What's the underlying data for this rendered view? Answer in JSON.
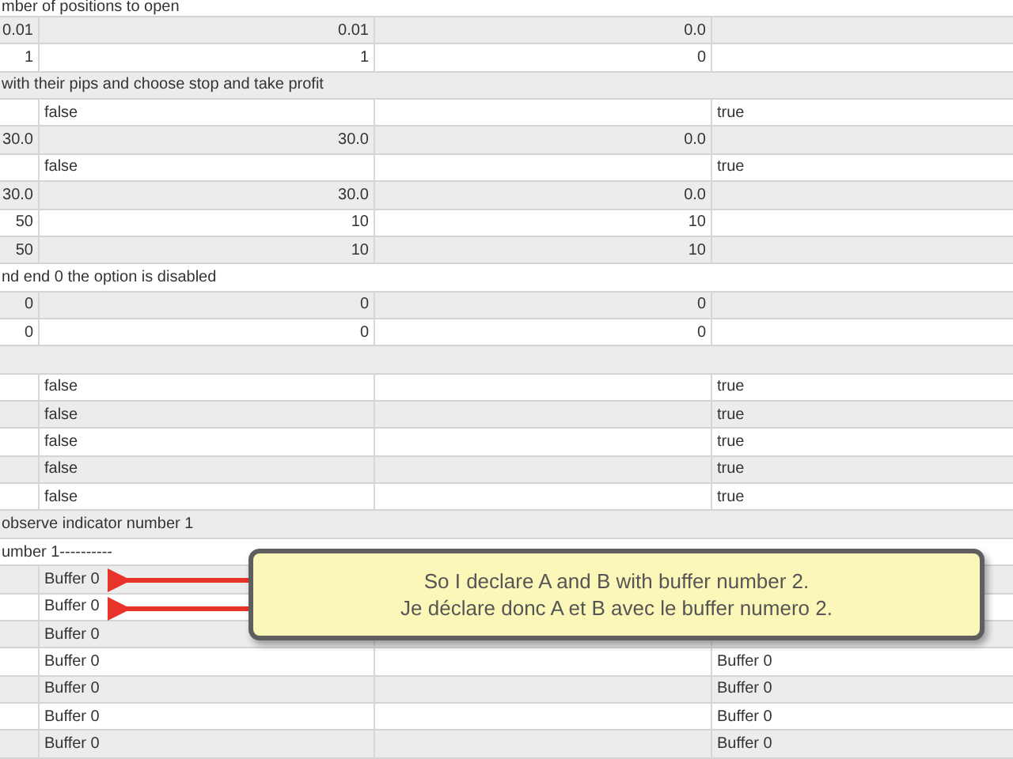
{
  "rows": [
    {
      "kind": "section",
      "label": "mber of positions to open"
    },
    {
      "kind": "numeric",
      "cells": [
        "0.01",
        "0.01",
        "0.0",
        ""
      ]
    },
    {
      "kind": "numeric",
      "cells": [
        "1",
        "1",
        "0",
        ""
      ]
    },
    {
      "kind": "section",
      "label": "with their pips and choose stop and take profit"
    },
    {
      "kind": "text",
      "cells": [
        "",
        "false",
        "",
        "true"
      ]
    },
    {
      "kind": "numeric",
      "cells": [
        "30.0",
        "30.0",
        "0.0",
        ""
      ]
    },
    {
      "kind": "text",
      "cells": [
        "",
        "false",
        "",
        "true"
      ]
    },
    {
      "kind": "numeric",
      "cells": [
        "30.0",
        "30.0",
        "0.0",
        ""
      ]
    },
    {
      "kind": "numeric",
      "cells": [
        "50",
        "10",
        "10",
        ""
      ]
    },
    {
      "kind": "numeric",
      "cells": [
        "50",
        "10",
        "10",
        ""
      ]
    },
    {
      "kind": "section",
      "label": "nd end 0 the option is disabled"
    },
    {
      "kind": "numeric",
      "cells": [
        "0",
        "0",
        "0",
        ""
      ]
    },
    {
      "kind": "numeric",
      "cells": [
        "0",
        "0",
        "0",
        ""
      ]
    },
    {
      "kind": "section",
      "label": ""
    },
    {
      "kind": "text",
      "cells": [
        "",
        "false",
        "",
        "true"
      ]
    },
    {
      "kind": "text",
      "cells": [
        "",
        "false",
        "",
        "true"
      ]
    },
    {
      "kind": "text",
      "cells": [
        "",
        "false",
        "",
        "true"
      ]
    },
    {
      "kind": "text",
      "cells": [
        "",
        "false",
        "",
        "true"
      ]
    },
    {
      "kind": "text",
      "cells": [
        "",
        "false",
        "",
        "true"
      ]
    },
    {
      "kind": "section",
      "label": "observe indicator number 1"
    },
    {
      "kind": "section",
      "label": "umber 1----------"
    },
    {
      "kind": "text",
      "cells": [
        "",
        "Buffer 0",
        "",
        ""
      ]
    },
    {
      "kind": "text",
      "cells": [
        "",
        "Buffer 0",
        "",
        ""
      ]
    },
    {
      "kind": "text",
      "cells": [
        "",
        "Buffer 0",
        "",
        ""
      ]
    },
    {
      "kind": "text",
      "cells": [
        "",
        "Buffer 0",
        "",
        "Buffer 0"
      ]
    },
    {
      "kind": "text",
      "cells": [
        "",
        "Buffer 0",
        "",
        "Buffer 0"
      ]
    },
    {
      "kind": "text",
      "cells": [
        "",
        "Buffer 0",
        "",
        "Buffer 0"
      ]
    },
    {
      "kind": "text",
      "cells": [
        "",
        "Buffer 0",
        "",
        "Buffer 0"
      ]
    }
  ],
  "callout": {
    "lines": [
      "So I declare A and B with buffer number 2.",
      "Je déclare donc A et B avec le buffer numero 2."
    ]
  }
}
